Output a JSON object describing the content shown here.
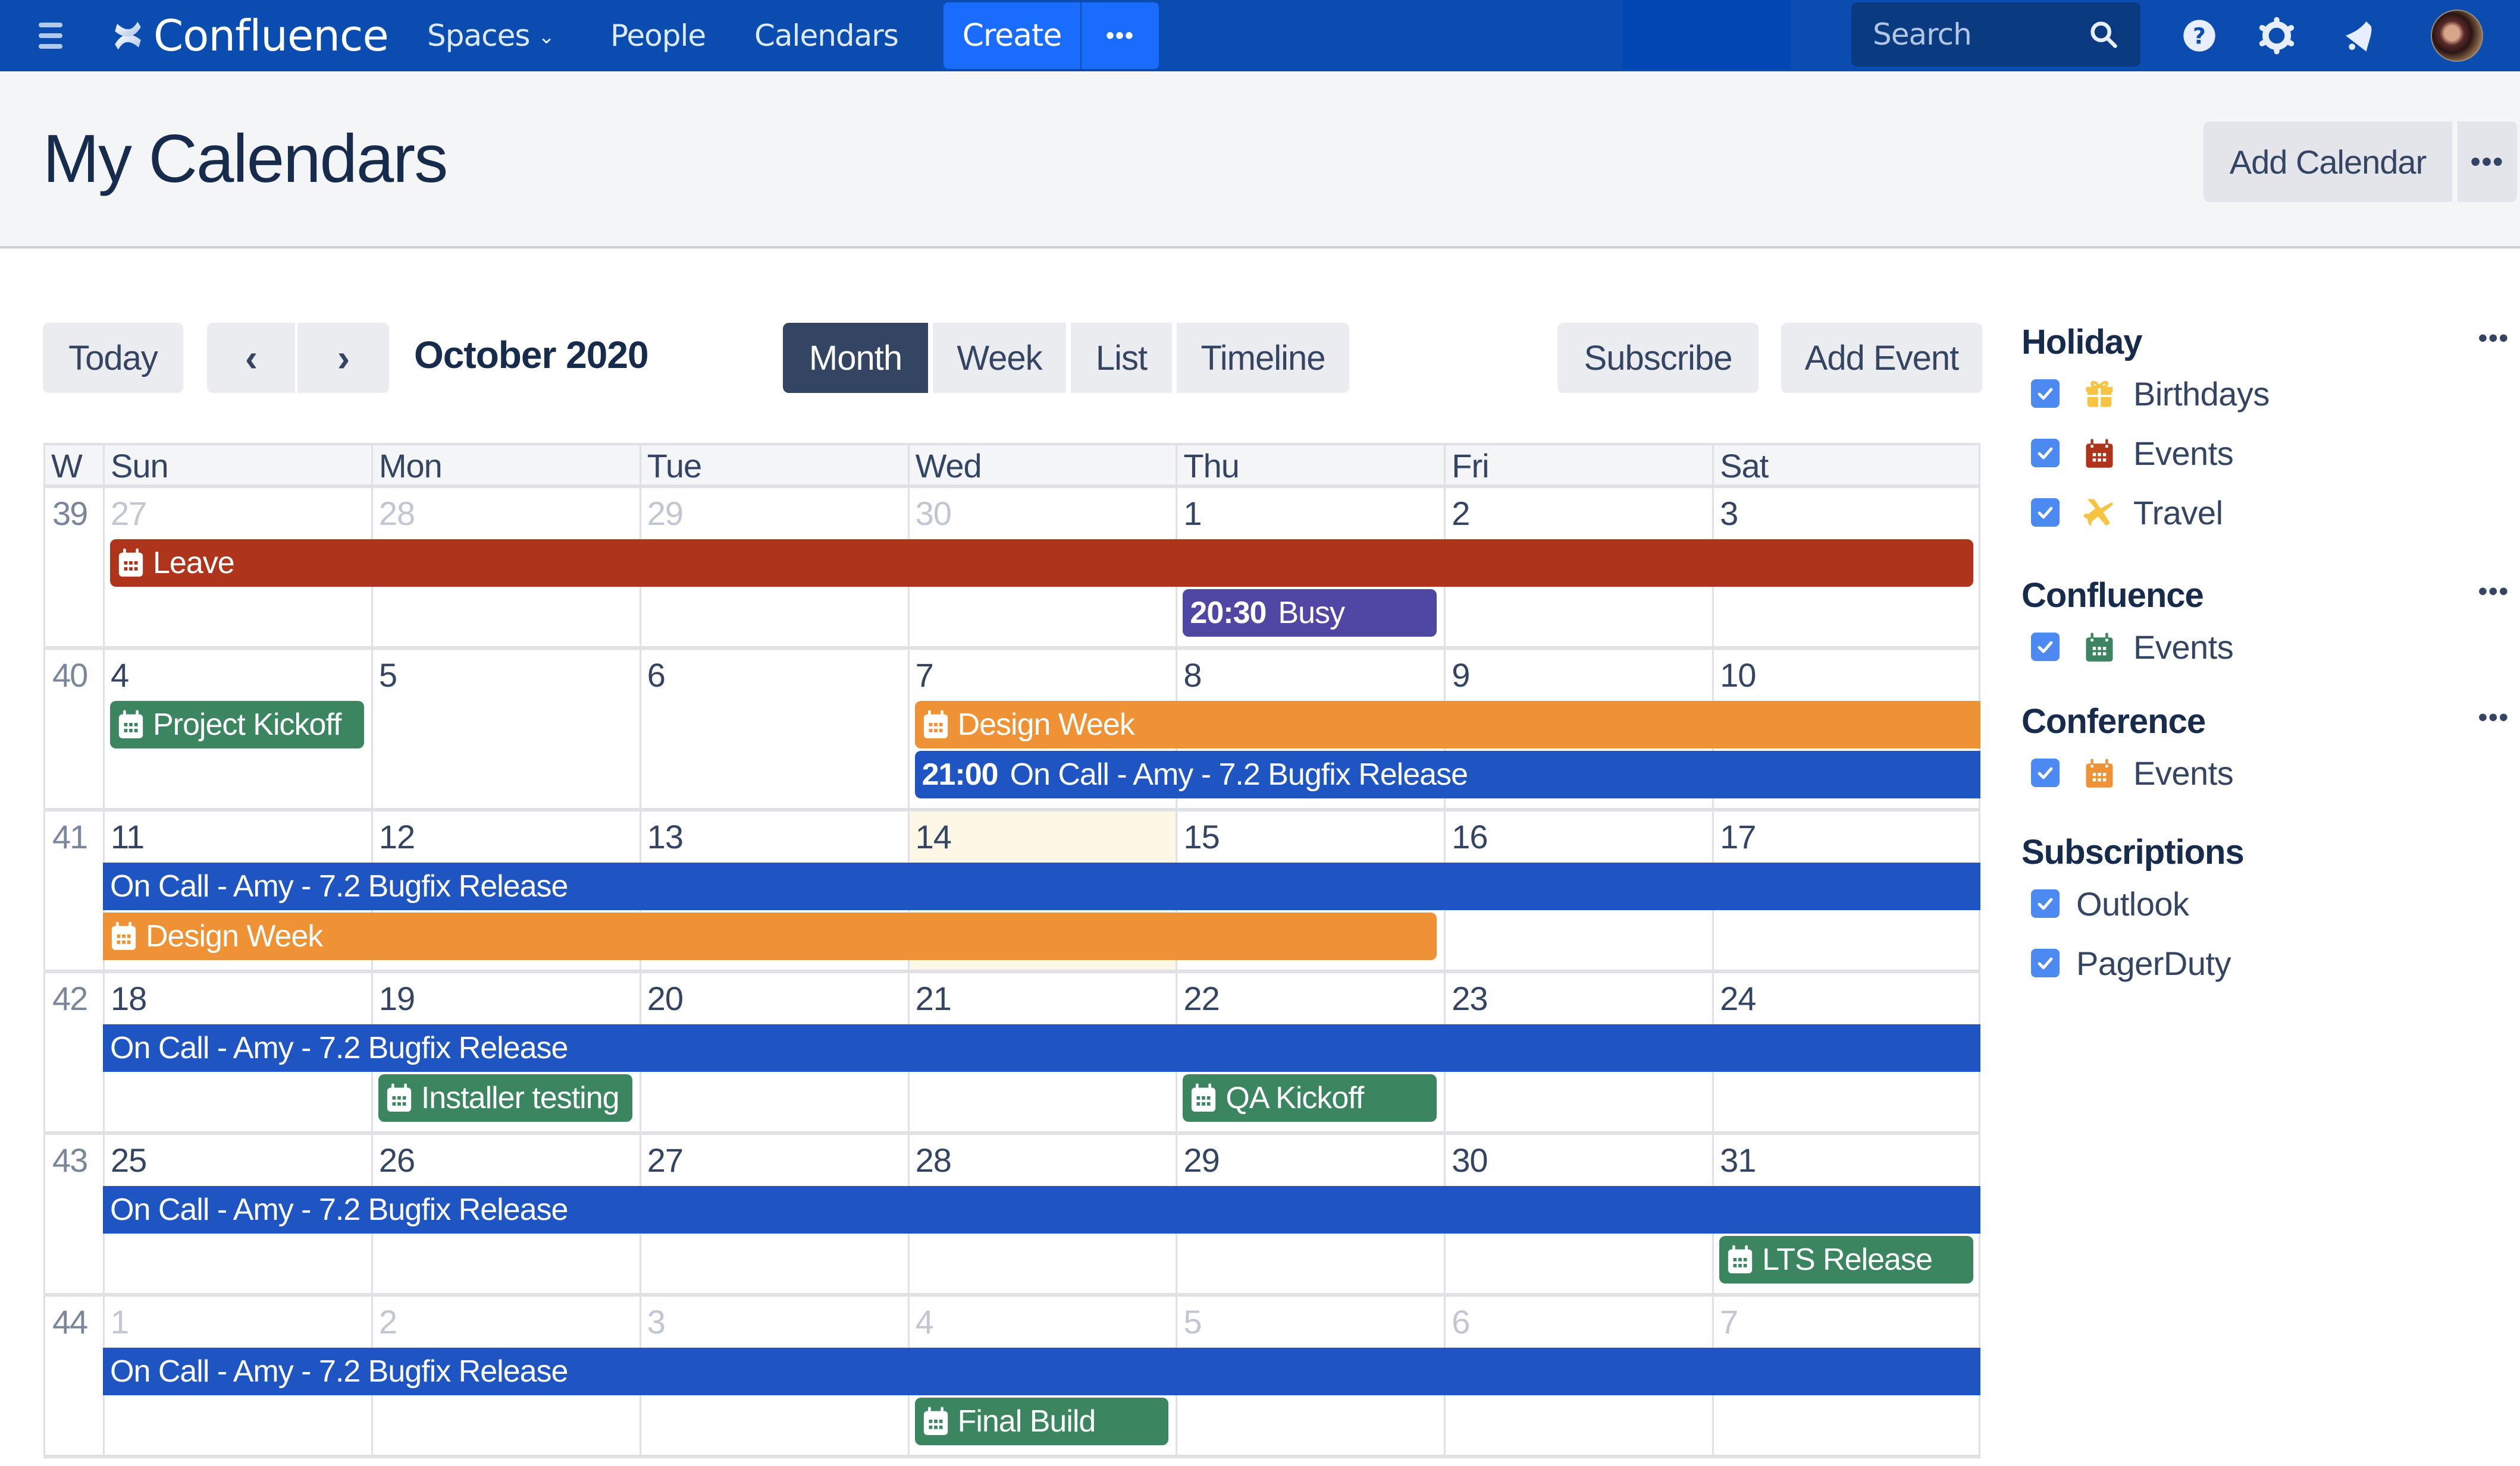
{
  "nav": {
    "app_name": "Confluence",
    "links": [
      {
        "label": "Spaces",
        "has_dropdown": true
      },
      {
        "label": "People",
        "has_dropdown": false
      },
      {
        "label": "Calendars",
        "has_dropdown": false
      }
    ],
    "create_label": "Create",
    "create_more_label": "•••",
    "search_placeholder": "Search",
    "icons": [
      "help-icon",
      "settings-gear-icon",
      "notifications-bell-icon"
    ],
    "brand_color": "#0b4cb1",
    "create_color": "#1a6cff"
  },
  "page": {
    "title": "My Calendars",
    "add_calendar_label": "Add Calendar",
    "more_label": "•••"
  },
  "toolbar": {
    "today_label": "Today",
    "prev_label": "‹",
    "next_label": "›",
    "month_title": "October 2020",
    "views": [
      {
        "label": "Month",
        "active": true
      },
      {
        "label": "Week",
        "active": false
      },
      {
        "label": "List",
        "active": false
      },
      {
        "label": "Timeline",
        "active": false
      }
    ],
    "subscribe_label": "Subscribe",
    "add_event_label": "Add Event"
  },
  "calendar": {
    "week_col_label": "W",
    "day_headers": [
      "Sun",
      "Mon",
      "Tue",
      "Wed",
      "Thu",
      "Fri",
      "Sat"
    ],
    "today": {
      "week": 2,
      "day": 3
    },
    "weeks": [
      {
        "number": "39",
        "days": [
          {
            "d": "27",
            "other": true
          },
          {
            "d": "28",
            "other": true
          },
          {
            "d": "29",
            "other": true
          },
          {
            "d": "30",
            "other": true
          },
          {
            "d": "1",
            "other": false
          },
          {
            "d": "2",
            "other": false
          },
          {
            "d": "3",
            "other": false
          }
        ]
      },
      {
        "number": "40",
        "days": [
          {
            "d": "4",
            "other": false
          },
          {
            "d": "5",
            "other": false
          },
          {
            "d": "6",
            "other": false
          },
          {
            "d": "7",
            "other": false
          },
          {
            "d": "8",
            "other": false
          },
          {
            "d": "9",
            "other": false
          },
          {
            "d": "10",
            "other": false
          }
        ]
      },
      {
        "number": "41",
        "days": [
          {
            "d": "11",
            "other": false
          },
          {
            "d": "12",
            "other": false
          },
          {
            "d": "13",
            "other": false
          },
          {
            "d": "14",
            "other": false
          },
          {
            "d": "15",
            "other": false
          },
          {
            "d": "16",
            "other": false
          },
          {
            "d": "17",
            "other": false
          }
        ]
      },
      {
        "number": "42",
        "days": [
          {
            "d": "18",
            "other": false
          },
          {
            "d": "19",
            "other": false
          },
          {
            "d": "20",
            "other": false
          },
          {
            "d": "21",
            "other": false
          },
          {
            "d": "22",
            "other": false
          },
          {
            "d": "23",
            "other": false
          },
          {
            "d": "24",
            "other": false
          }
        ]
      },
      {
        "number": "43",
        "days": [
          {
            "d": "25",
            "other": false
          },
          {
            "d": "26",
            "other": false
          },
          {
            "d": "27",
            "other": false
          },
          {
            "d": "28",
            "other": false
          },
          {
            "d": "29",
            "other": false
          },
          {
            "d": "30",
            "other": false
          },
          {
            "d": "31",
            "other": false
          }
        ]
      },
      {
        "number": "44",
        "days": [
          {
            "d": "1",
            "other": true
          },
          {
            "d": "2",
            "other": true
          },
          {
            "d": "3",
            "other": true
          },
          {
            "d": "4",
            "other": true
          },
          {
            "d": "5",
            "other": true
          },
          {
            "d": "6",
            "other": true
          },
          {
            "d": "7",
            "other": true
          }
        ]
      }
    ],
    "event_colors": {
      "leave": "#ae341c",
      "busy": "#5047a4",
      "confluence": "#3b8660",
      "conference": "#ef9135",
      "oncall": "#1f55c3"
    },
    "events": [
      {
        "week": 0,
        "start": 0,
        "end": 6,
        "lane": 0,
        "title": "Leave",
        "time": "",
        "icon": true,
        "color": "leave",
        "cont_left": false,
        "cont_right": false
      },
      {
        "week": 0,
        "start": 4,
        "end": 4,
        "lane": 1,
        "title": "Busy",
        "time": "20:30",
        "icon": false,
        "color": "busy",
        "cont_left": false,
        "cont_right": false
      },
      {
        "week": 1,
        "start": 0,
        "end": 0,
        "lane": 0,
        "title": "Project Kickoff",
        "time": "",
        "icon": true,
        "color": "confluence",
        "cont_left": false,
        "cont_right": false
      },
      {
        "week": 1,
        "start": 3,
        "end": 6,
        "lane": 0,
        "title": "Design Week",
        "time": "",
        "icon": true,
        "color": "conference",
        "cont_left": false,
        "cont_right": true
      },
      {
        "week": 1,
        "start": 3,
        "end": 6,
        "lane": 1,
        "title": "On Call - Amy - 7.2 Bugfix Release",
        "time": "21:00",
        "icon": false,
        "color": "oncall",
        "cont_left": false,
        "cont_right": true
      },
      {
        "week": 2,
        "start": 0,
        "end": 6,
        "lane": 0,
        "title": "On Call - Amy - 7.2 Bugfix Release",
        "time": "",
        "icon": false,
        "color": "oncall",
        "cont_left": true,
        "cont_right": true
      },
      {
        "week": 2,
        "start": 0,
        "end": 4,
        "lane": 1,
        "title": "Design Week",
        "time": "",
        "icon": true,
        "color": "conference",
        "cont_left": true,
        "cont_right": false
      },
      {
        "week": 3,
        "start": 0,
        "end": 6,
        "lane": 0,
        "title": "On Call - Amy - 7.2 Bugfix Release",
        "time": "",
        "icon": false,
        "color": "oncall",
        "cont_left": true,
        "cont_right": true
      },
      {
        "week": 3,
        "start": 1,
        "end": 1,
        "lane": 1,
        "title": "Installer testing",
        "time": "",
        "icon": true,
        "color": "confluence",
        "cont_left": false,
        "cont_right": false
      },
      {
        "week": 3,
        "start": 4,
        "end": 4,
        "lane": 1,
        "title": "QA Kickoff",
        "time": "",
        "icon": true,
        "color": "confluence",
        "cont_left": false,
        "cont_right": false
      },
      {
        "week": 4,
        "start": 0,
        "end": 6,
        "lane": 0,
        "title": "On Call - Amy - 7.2 Bugfix Release",
        "time": "",
        "icon": false,
        "color": "oncall",
        "cont_left": true,
        "cont_right": true
      },
      {
        "week": 4,
        "start": 6,
        "end": 6,
        "lane": 1,
        "title": "LTS Release",
        "time": "",
        "icon": true,
        "color": "confluence",
        "cont_left": false,
        "cont_right": false
      },
      {
        "week": 5,
        "start": 0,
        "end": 6,
        "lane": 0,
        "title": "On Call - Amy - 7.2 Bugfix Release",
        "time": "",
        "icon": false,
        "color": "oncall",
        "cont_left": true,
        "cont_right": true
      },
      {
        "week": 5,
        "start": 3,
        "end": 3,
        "lane": 1,
        "title": "Final Build",
        "time": "",
        "icon": true,
        "color": "confluence",
        "cont_left": false,
        "cont_right": false
      }
    ]
  },
  "sidebar": {
    "groups": [
      {
        "title": "Holiday",
        "has_more": true,
        "items": [
          {
            "label": "Birthdays",
            "checked": true,
            "icon": "gift-icon",
            "color": "#f6c342"
          },
          {
            "label": "Events",
            "checked": true,
            "icon": "calendar-icon",
            "color": "#ae341c"
          },
          {
            "label": "Travel",
            "checked": true,
            "icon": "airplane-icon",
            "color": "#f6c342"
          }
        ]
      },
      {
        "title": "Confluence",
        "has_more": true,
        "items": [
          {
            "label": "Events",
            "checked": true,
            "icon": "calendar-icon",
            "color": "#3b8660"
          }
        ]
      },
      {
        "title": "Conference",
        "has_more": true,
        "items": [
          {
            "label": "Events",
            "checked": true,
            "icon": "calendar-icon",
            "color": "#ef9135"
          }
        ]
      },
      {
        "title": "Subscriptions",
        "has_more": false,
        "items": [
          {
            "label": "Outlook",
            "checked": true,
            "icon": "",
            "color": ""
          },
          {
            "label": "PagerDuty",
            "checked": true,
            "icon": "",
            "color": ""
          }
        ]
      }
    ],
    "more_label": "•••"
  }
}
